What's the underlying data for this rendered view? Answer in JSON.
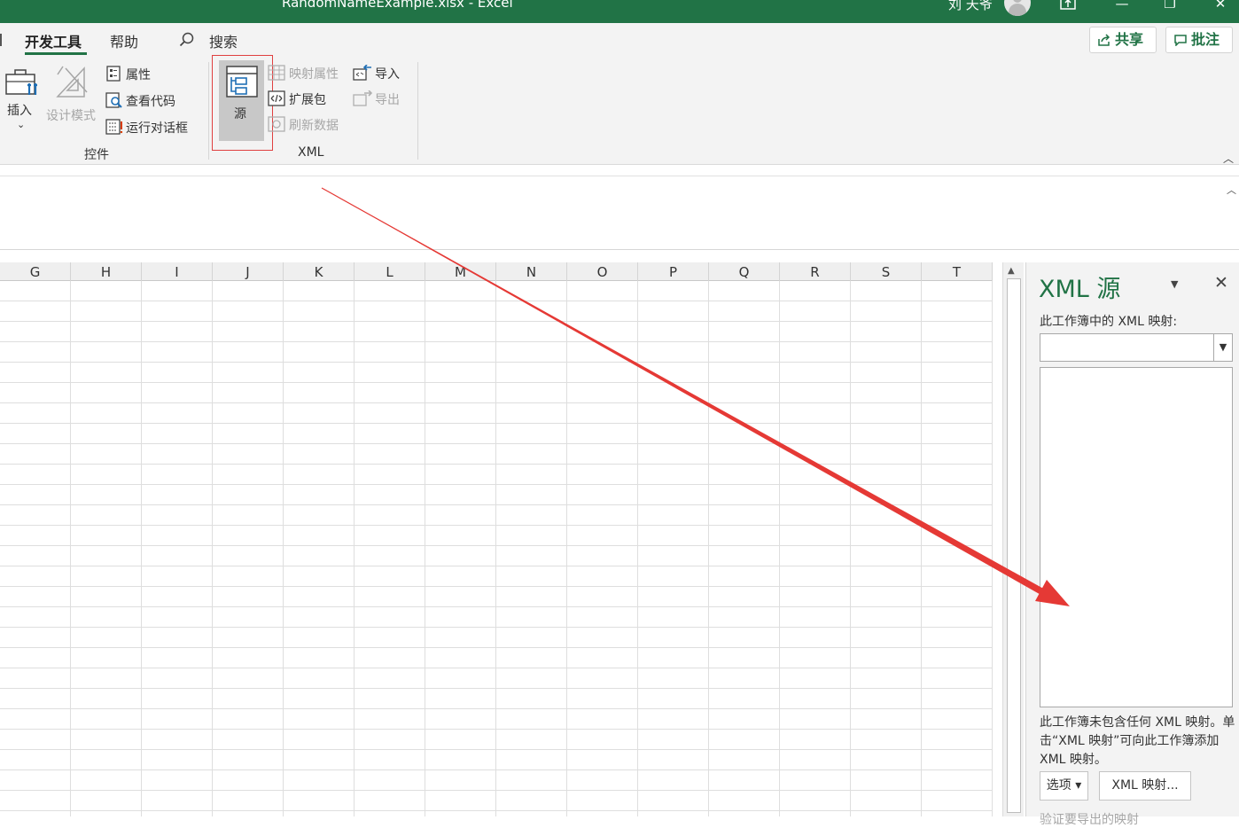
{
  "window": {
    "title": "RandomNameExample.xlsx  -  Excel",
    "user": "刘 天爷",
    "controls": {
      "minimize": "—",
      "restore": "❐",
      "close": "✕"
    }
  },
  "tabs": {
    "developer": "开发工具",
    "help": "帮助",
    "search": "搜索"
  },
  "top_buttons": {
    "share": "共享",
    "comments": "批注"
  },
  "ribbon": {
    "controls_group": {
      "label": "控件",
      "insert": "插入",
      "design_mode": "设计模式",
      "properties": "属性",
      "view_code": "查看代码",
      "run_dialog": "运行对话框"
    },
    "xml_group": {
      "label": "XML",
      "source": "源",
      "map_properties": "映射属性",
      "expansion_packs": "扩展包",
      "refresh_data": "刷新数据",
      "import": "导入",
      "export": "导出"
    }
  },
  "grid": {
    "columns": [
      "G",
      "H",
      "I",
      "J",
      "K",
      "L",
      "M",
      "N",
      "O",
      "P",
      "Q",
      "R",
      "S",
      "T"
    ]
  },
  "xml_pane": {
    "title": "XML 源",
    "maps_label": "此工作簿中的 XML 映射:",
    "info_text": "此工作簿未包含任何 XML 映射。单击“XML 映射”可向此工作簿添加 XML 映射。",
    "options_button": "选项 ▾",
    "xml_maps_button": "XML 映射...",
    "verify_text": "验证要导出的映射"
  },
  "colors": {
    "accent": "#217346",
    "annotation": "#e53935"
  }
}
